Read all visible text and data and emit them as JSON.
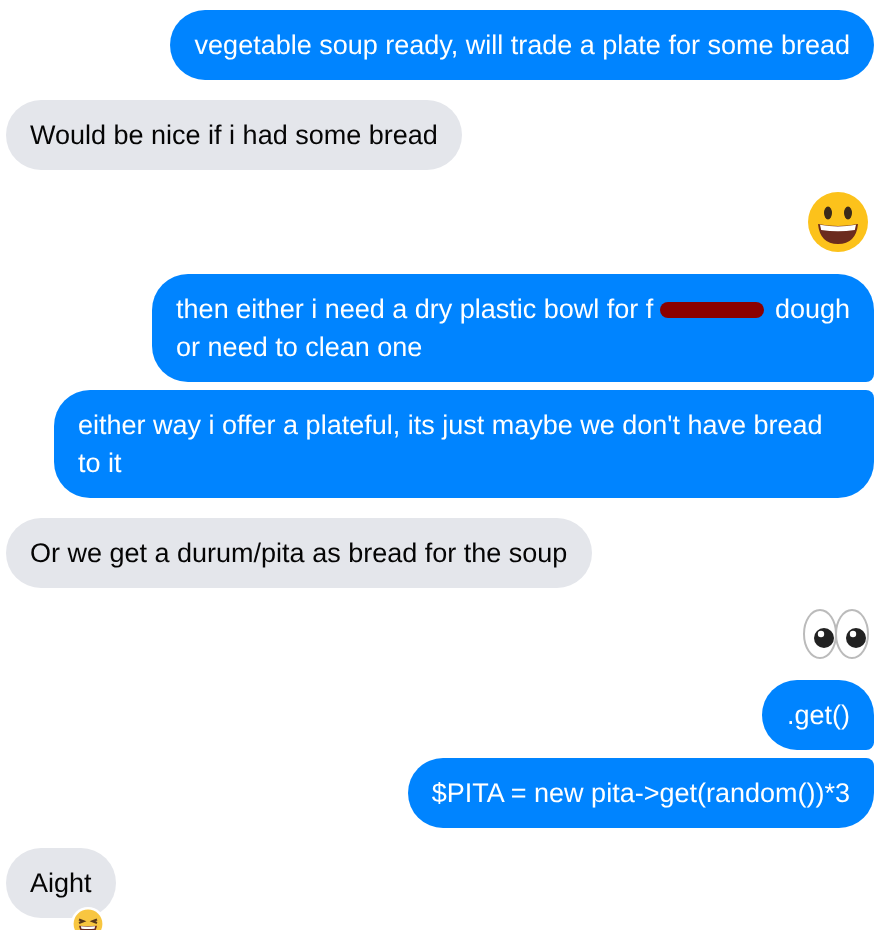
{
  "messages": [
    {
      "kind": "text",
      "outgoing": true,
      "parts": [
        "vegetable soup ready, will trade a plate for some bread"
      ]
    },
    {
      "kind": "text",
      "outgoing": false,
      "parts": [
        "Would be nice if i had some bread"
      ]
    },
    {
      "kind": "smiley"
    },
    {
      "kind": "text",
      "outgoing": true,
      "parts": [
        "then either i need a dry plastic bowl for f",
        "dough",
        "or need to clean one"
      ],
      "redacted": true
    },
    {
      "kind": "text",
      "outgoing": true,
      "parts": [
        "either way i offer a plateful, its just maybe we don't have bread to it"
      ]
    },
    {
      "kind": "text",
      "outgoing": false,
      "parts": [
        "Or we get a durum/pita as bread for the soup"
      ]
    },
    {
      "kind": "eyes"
    },
    {
      "kind": "text",
      "outgoing": true,
      "parts": [
        ".get()"
      ]
    },
    {
      "kind": "text",
      "outgoing": true,
      "parts": [
        "$PITA = new pita->get(random())*3"
      ]
    },
    {
      "kind": "text",
      "outgoing": false,
      "parts": [
        "Aight"
      ],
      "reaction": true
    }
  ]
}
